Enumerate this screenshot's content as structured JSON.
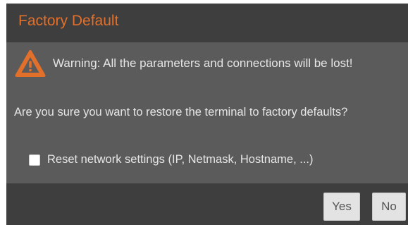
{
  "dialog": {
    "title": "Factory Default",
    "warning_text": "Warning: All the parameters and connections will be lost!",
    "question_text": "Are you sure you want to restore the terminal to factory defaults?",
    "checkbox": {
      "label": "Reset network settings (IP, Netmask, Hostname, ...)",
      "checked": false
    },
    "buttons": {
      "yes_label": "Yes",
      "no_label": "No"
    }
  },
  "icons": {
    "warning": "warning-triangle-icon"
  },
  "colors": {
    "title_accent": "#e2702b",
    "warning_icon": "#e2702b",
    "body_background": "#5b5b5b",
    "bar_background": "#3e3e3e",
    "text": "#e6e6e6",
    "button_background": "#e3e3e3"
  }
}
